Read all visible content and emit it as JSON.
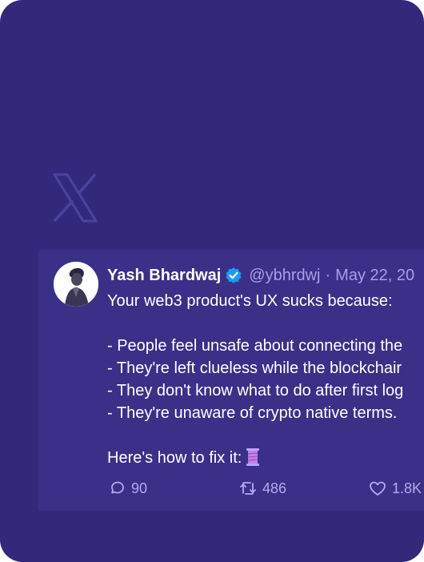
{
  "tweet": {
    "author_name": "Yash Bhardwaj",
    "handle": "@ybhrdwj",
    "separator": "·",
    "date": "May 22, 20",
    "lines": [
      "Your web3 product's UX sucks because:",
      "",
      "- People feel unsafe about connecting the",
      "- They're left clueless while the blockchair",
      "- They don't know what to do after first log",
      "- They're unaware of crypto native terms.",
      "",
      "Here's how to fix it:"
    ],
    "thread_emoji_icon": "thread-spool-icon",
    "actions": {
      "replies": "90",
      "reposts": "486",
      "likes": "1.8K"
    }
  },
  "icons": {
    "brand": "x-logo-icon",
    "verified": "verified-badge-icon",
    "reply": "reply-icon",
    "repost": "repost-icon",
    "like": "heart-icon"
  },
  "colors": {
    "card_background": "#33297a",
    "tweet_background": "#3a3088",
    "text": "#ffffff",
    "muted_text": "#a79ee8",
    "verified_badge": "#1d9bf0"
  }
}
